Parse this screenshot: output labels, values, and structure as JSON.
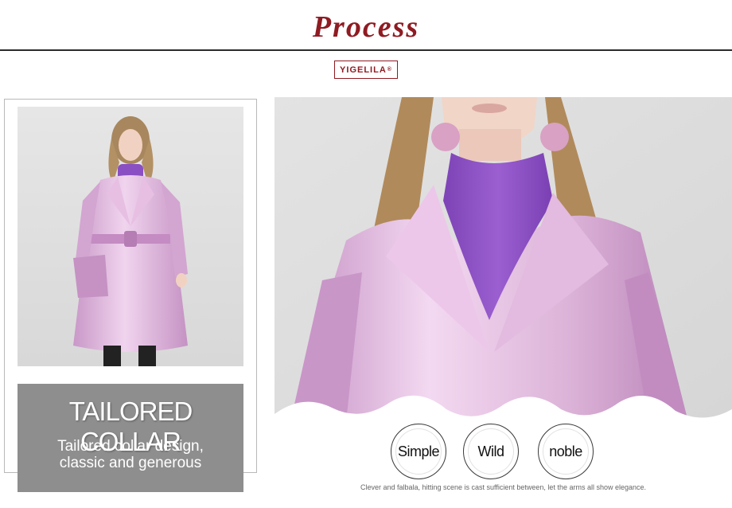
{
  "header": {
    "title": "Process",
    "brand_text": "YIGELILA",
    "brand_mark": "®"
  },
  "left_panel": {
    "image": "full-length-coat-photo",
    "caption_title": "TAILORED COLLAR",
    "caption_line1": "Tailored collar design,",
    "caption_line2": "classic and generous"
  },
  "right_panel": {
    "image": "collar-closeup-photo",
    "keywords": [
      "Simple",
      "Wild",
      "noble"
    ],
    "footer_note": "Clever and falbala, hitting scene is cast sufficient between, let the arms all show elegance."
  },
  "colors": {
    "accent": "#8f1b22",
    "caption_bg": "#8e8e8e",
    "coat": "#dcb3d8",
    "sweater": "#8a4fc2"
  }
}
